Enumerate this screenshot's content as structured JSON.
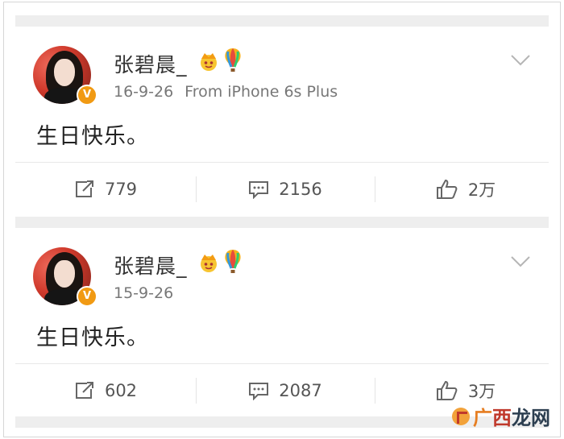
{
  "posts": [
    {
      "username": "张碧晨_",
      "date": "16-9-26",
      "source": "From iPhone 6s Plus",
      "content": "生日快乐。",
      "reposts": "779",
      "comments": "2156",
      "likes": "2万",
      "verified_badge": "V"
    },
    {
      "username": "张碧晨_",
      "date": "15-9-26",
      "source": "",
      "content": "生日快乐。",
      "reposts": "602",
      "comments": "2087",
      "likes": "3万",
      "verified_badge": "V"
    }
  ],
  "icons": {
    "crown": "crown-emoji-icon",
    "balloon": "hot-air-balloon-icon",
    "chevron": "chevron-down-icon",
    "repost": "repost-icon",
    "comment": "comment-icon",
    "like": "thumbs-up-icon"
  },
  "watermark": {
    "part1": "广",
    "part2": "西",
    "part3": "龙网"
  },
  "colors": {
    "badge": "#f19a13",
    "separator": "#eeeeee",
    "text_secondary": "#777777"
  }
}
